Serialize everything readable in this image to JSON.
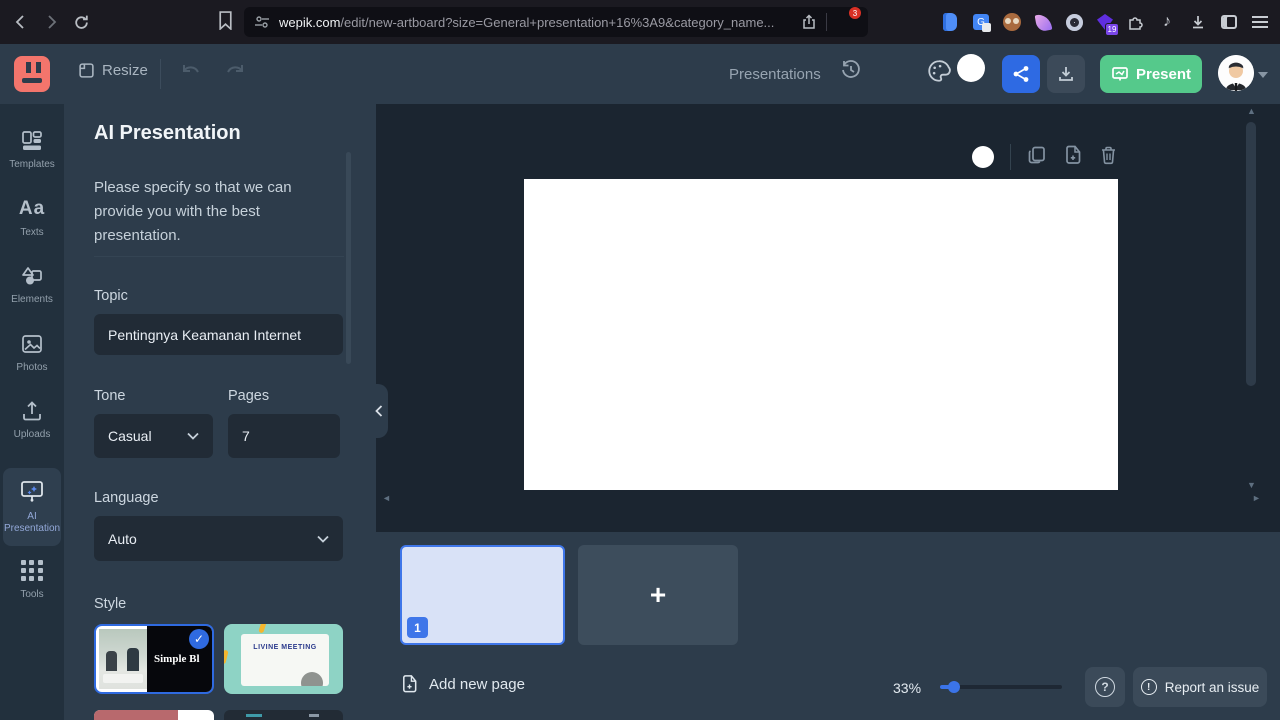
{
  "browser": {
    "url_domain": "wepik.com",
    "url_path": "/edit/new-artboard?size=General+presentation+16%3A9&category_name...",
    "shield_badge": "3",
    "extension_badge": "19"
  },
  "toolbar": {
    "resize_label": "Resize",
    "context_label": "Presentations",
    "present_label": "Present"
  },
  "sidebar": {
    "items": [
      {
        "label": "Templates"
      },
      {
        "label": "Texts"
      },
      {
        "label": "Elements"
      },
      {
        "label": "Photos"
      },
      {
        "label": "Uploads"
      },
      {
        "label": "AI Presentation"
      },
      {
        "label": "Tools"
      }
    ]
  },
  "panel": {
    "title": "AI Presentation",
    "description": "Please specify so that we can provide you with the best presentation.",
    "topic": {
      "label": "Topic",
      "value": "Pentingnya Keamanan Internet"
    },
    "tone": {
      "label": "Tone",
      "value": "Casual"
    },
    "pages": {
      "label": "Pages",
      "value": "7"
    },
    "language": {
      "label": "Language",
      "value": "Auto"
    },
    "style": {
      "label": "Style",
      "options": [
        {
          "name": "Simple Bl"
        },
        {
          "name": "LIVINE MEETING"
        }
      ]
    }
  },
  "pages_panel": {
    "active_page_number": "1",
    "add_new_page_label": "Add new page",
    "zoom_value": "33%",
    "help_glyph": "?",
    "report_glyph": "!",
    "report_issue_label": "Report an issue",
    "add_tile_glyph": "+"
  }
}
